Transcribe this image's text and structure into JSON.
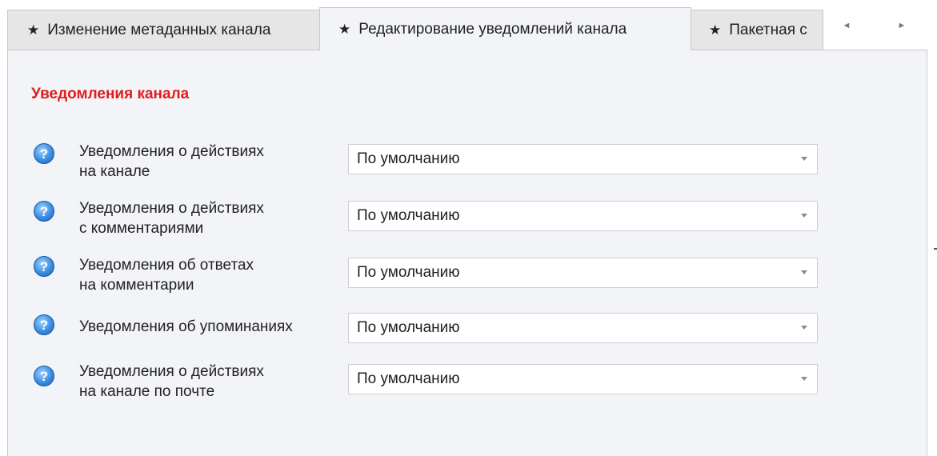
{
  "tabs": [
    {
      "label": "Изменение метаданных канала",
      "active": false
    },
    {
      "label": "Редактирование уведомлений канала",
      "active": true
    },
    {
      "label": "Пакетная с",
      "active": false
    }
  ],
  "tab_star": "★",
  "tab_scroll": {
    "left_glyph": "◄",
    "right_glyph": "►"
  },
  "section": {
    "title": "Уведомления канала",
    "title_color": "#e31b1b"
  },
  "help_glyph": "?",
  "rows": [
    {
      "label_line1": "Уведомления о действиях",
      "label_line2": "на канале",
      "value": "По умолчанию"
    },
    {
      "label_line1": "Уведомления о действиях",
      "label_line2": "с комментариями",
      "value": "По умолчанию"
    },
    {
      "label_line1": "Уведомления об ответах",
      "label_line2": "на комментарии",
      "value": "По умолчанию"
    },
    {
      "label_line1": "Уведомления об упоминаниях",
      "label_line2": "",
      "value": "По умолчанию"
    },
    {
      "label_line1": "Уведомления о действиях",
      "label_line2": "на канале по почте",
      "value": "По умолчанию"
    }
  ]
}
